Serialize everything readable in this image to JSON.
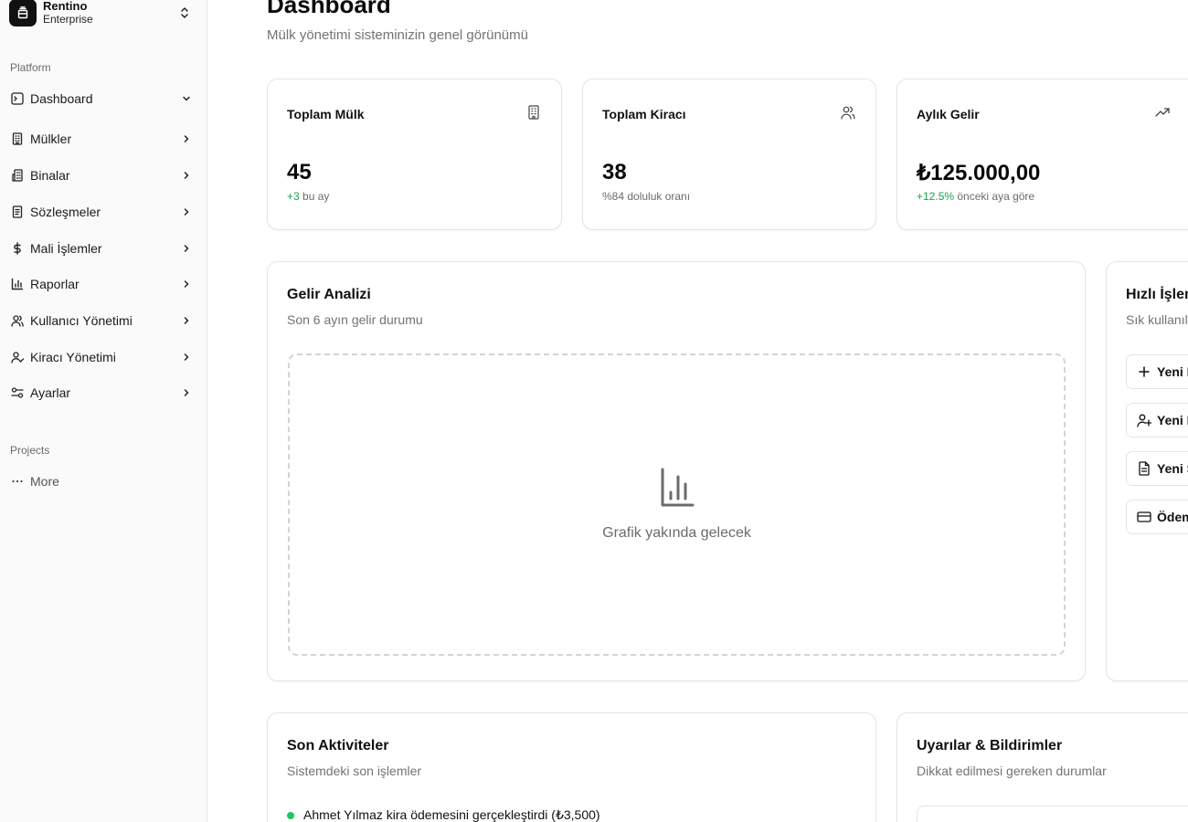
{
  "sidebar": {
    "team": {
      "name": "Rentino",
      "plan": "Enterprise"
    },
    "platform_label": "Platform",
    "items": [
      {
        "label": "Dashboard",
        "icon": "dashboard-icon"
      },
      {
        "label": "Mülkler",
        "icon": "building-icon"
      },
      {
        "label": "Binalar",
        "icon": "buildings-icon"
      },
      {
        "label": "Sözleşmeler",
        "icon": "document-icon"
      },
      {
        "label": "Mali İşlemler",
        "icon": "dollar-icon"
      },
      {
        "label": "Raporlar",
        "icon": "bar-chart-icon"
      },
      {
        "label": "Kullanıcı Yönetimi",
        "icon": "users-icon"
      },
      {
        "label": "Kiracı Yönetimi",
        "icon": "user-check-icon"
      },
      {
        "label": "Ayarlar",
        "icon": "settings-icon"
      }
    ],
    "projects_label": "Projects",
    "more_label": "More"
  },
  "header": {
    "title": "Dashboard",
    "subtitle": "Mülk yönetimi sisteminizin genel görünümü"
  },
  "stats": [
    {
      "title": "Toplam Mülk",
      "value": "45",
      "note_highlight": "+3",
      "note_rest": " bu ay",
      "icon": "building-icon"
    },
    {
      "title": "Toplam Kiracı",
      "value": "38",
      "note_highlight": "",
      "note_rest": "%84 doluluk oranı",
      "icon": "users-icon"
    },
    {
      "title": "Aylık Gelir",
      "value": "₺125.000,00",
      "note_highlight": "+12.5%",
      "note_rest": " önceki aya göre",
      "icon": "trending-up-icon"
    }
  ],
  "revenue": {
    "title": "Gelir Analizi",
    "subtitle": "Son 6 ayın gelir durumu",
    "placeholder": "Grafik yakında gelecek"
  },
  "quick_actions": {
    "title": "Hızlı İşlem",
    "subtitle": "Sık kullanılar",
    "buttons": [
      {
        "label": "Yeni M",
        "icon": "plus-icon"
      },
      {
        "label": "Yeni K",
        "icon": "user-plus-icon"
      },
      {
        "label": "Yeni S",
        "icon": "file-text-icon"
      },
      {
        "label": "Ödem",
        "icon": "credit-card-icon"
      }
    ]
  },
  "activities": {
    "title": "Son Aktiviteler",
    "subtitle": "Sistemdeki son işlemler",
    "items": [
      {
        "text": "Ahmet Yılmaz kira ödemesini gerçekleştirdi (₺3,500)",
        "color": "#22c55e"
      }
    ]
  },
  "alerts": {
    "title": "Uyarılar & Bildirimler",
    "subtitle": "Dikkat edilmesi gereken durumlar"
  },
  "colors": {
    "positive": "#16a34a",
    "status_dot": "#22c55e",
    "accent_dark": "#111111"
  }
}
